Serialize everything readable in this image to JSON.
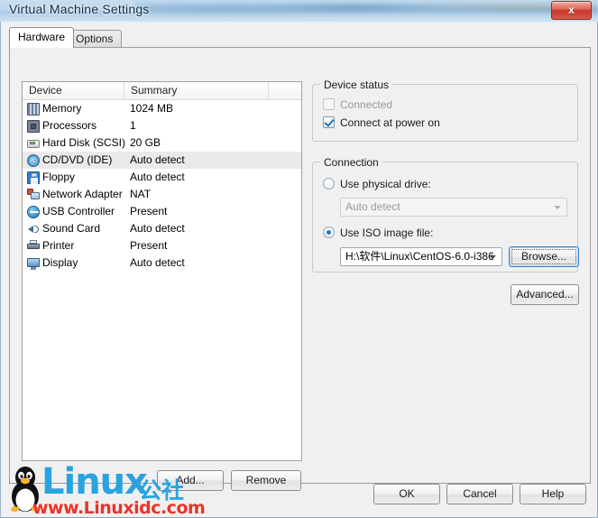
{
  "window": {
    "title": "Virtual Machine Settings",
    "close_label": "x"
  },
  "tabs": [
    {
      "label": "Hardware",
      "active": true
    },
    {
      "label": "Options",
      "active": false
    }
  ],
  "device_list": {
    "columns": [
      "Device",
      "Summary",
      ""
    ],
    "rows": [
      {
        "icon": "memory-icon",
        "device": "Memory",
        "summary": "1024 MB",
        "selected": false
      },
      {
        "icon": "processor-icon",
        "device": "Processors",
        "summary": "1",
        "selected": false
      },
      {
        "icon": "hard-disk-icon",
        "device": "Hard Disk (SCSI)",
        "summary": "20 GB",
        "selected": false
      },
      {
        "icon": "cd-dvd-icon",
        "device": "CD/DVD (IDE)",
        "summary": "Auto detect",
        "selected": true
      },
      {
        "icon": "floppy-icon",
        "device": "Floppy",
        "summary": "Auto detect",
        "selected": false
      },
      {
        "icon": "network-adapter-icon",
        "device": "Network Adapter",
        "summary": "NAT",
        "selected": false
      },
      {
        "icon": "usb-controller-icon",
        "device": "USB Controller",
        "summary": "Present",
        "selected": false
      },
      {
        "icon": "sound-card-icon",
        "device": "Sound Card",
        "summary": "Auto detect",
        "selected": false
      },
      {
        "icon": "printer-icon",
        "device": "Printer",
        "summary": "Present",
        "selected": false
      },
      {
        "icon": "display-icon",
        "device": "Display",
        "summary": "Auto detect",
        "selected": false
      }
    ]
  },
  "list_buttons": {
    "add": "Add...",
    "remove": "Remove"
  },
  "device_status": {
    "title": "Device status",
    "connected": {
      "label": "Connected",
      "checked": false,
      "disabled": true
    },
    "connect_at_power_on": {
      "label": "Connect at power on",
      "checked": true,
      "disabled": false
    }
  },
  "connection": {
    "title": "Connection",
    "physical_drive": {
      "label": "Use physical drive:",
      "selected": false
    },
    "physical_drive_value": "Auto detect",
    "iso_image": {
      "label": "Use ISO image file:",
      "selected": true
    },
    "iso_path": "H:\\软件\\Linux\\CentOS-6.0-i386",
    "browse_label": "Browse...",
    "advanced_label": "Advanced..."
  },
  "dialog_buttons": {
    "ok": "OK",
    "cancel": "Cancel",
    "help": "Help"
  },
  "watermark": {
    "linux": "Linux",
    "cn": "公社",
    "url": "www.Linuxidc.com"
  }
}
